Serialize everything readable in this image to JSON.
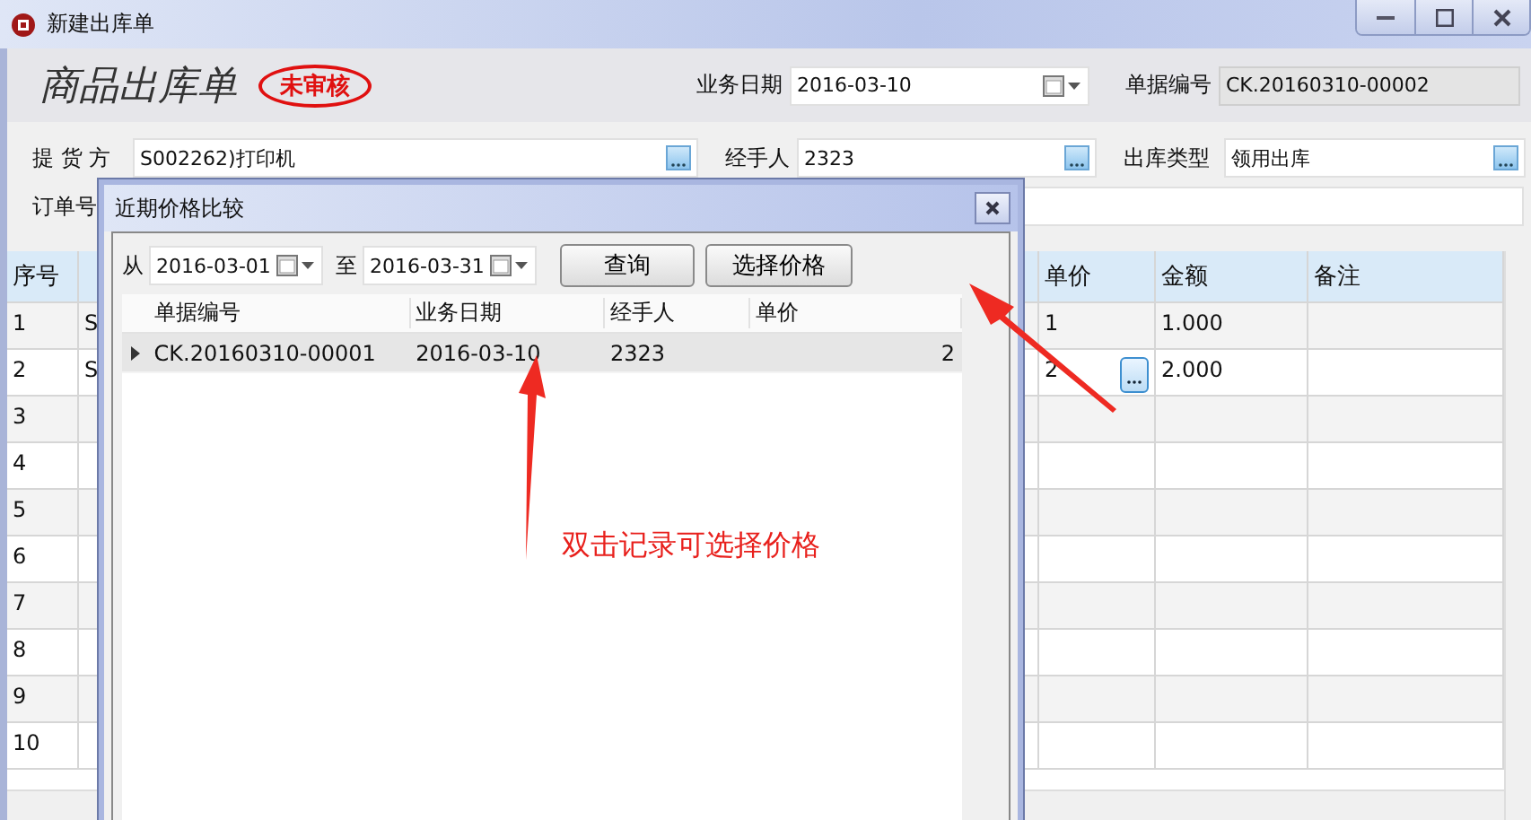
{
  "window": {
    "title": "新建出库单"
  },
  "header": {
    "title": "商品出库单",
    "status": {
      "label": "未审核",
      "kind": "unaudited"
    },
    "fields": [
      {
        "label": "业务日期",
        "value": "2016-03-10",
        "kind": "date"
      },
      {
        "label": "单据编号",
        "value": "CK.20160310-00002",
        "kind": "readonly"
      }
    ]
  },
  "form_rows": [
    {
      "fields": [
        {
          "label": "提 货 方",
          "value": "S002262)打印机",
          "kind": "lookup"
        },
        {
          "label": "经手人",
          "value": "2323",
          "kind": "lookup"
        },
        {
          "label": "出库类型",
          "value": "领用出库",
          "kind": "lookup"
        }
      ]
    },
    {
      "fields": [
        {
          "label": "订单号",
          "kind": "text"
        }
      ]
    }
  ],
  "table": {
    "columns": [
      {
        "label": "序号"
      },
      {},
      {
        "label": "单价"
      },
      {
        "label": "金额"
      },
      {
        "label": "备注"
      }
    ],
    "rows": [
      {
        "index": "1",
        "column_2": "S",
        "unit_price": "1",
        "amount": "1.000",
        "selected": false
      },
      {
        "index": "2",
        "column_2": "S",
        "unit_price": "2",
        "amount": "2.000",
        "selected": true
      },
      {
        "index": "3",
        "selected": false
      },
      {
        "index": "4",
        "selected": false
      },
      {
        "index": "5",
        "selected": false
      },
      {
        "index": "6",
        "selected": false
      },
      {
        "index": "7",
        "selected": false
      },
      {
        "index": "8",
        "selected": false
      },
      {
        "index": "9",
        "selected": false
      },
      {
        "index": "10",
        "selected": false
      }
    ]
  },
  "dialog": {
    "title": "近期价格比较",
    "filter": {
      "from_label": "从",
      "from": "2016-03-01",
      "to_label": "至",
      "to": "2016-03-31"
    },
    "buttons": [
      "查询",
      "选择价格"
    ],
    "table": {
      "columns": [
        "单据编号",
        "业务日期",
        "经手人",
        "单价"
      ],
      "rows": [
        {
          "cells": [
            "CK.20160310-00001",
            "2016-03-10",
            "2323",
            "2"
          ],
          "selected": true
        }
      ]
    }
  },
  "annotation": {
    "text": "双击记录可选择价格"
  }
}
